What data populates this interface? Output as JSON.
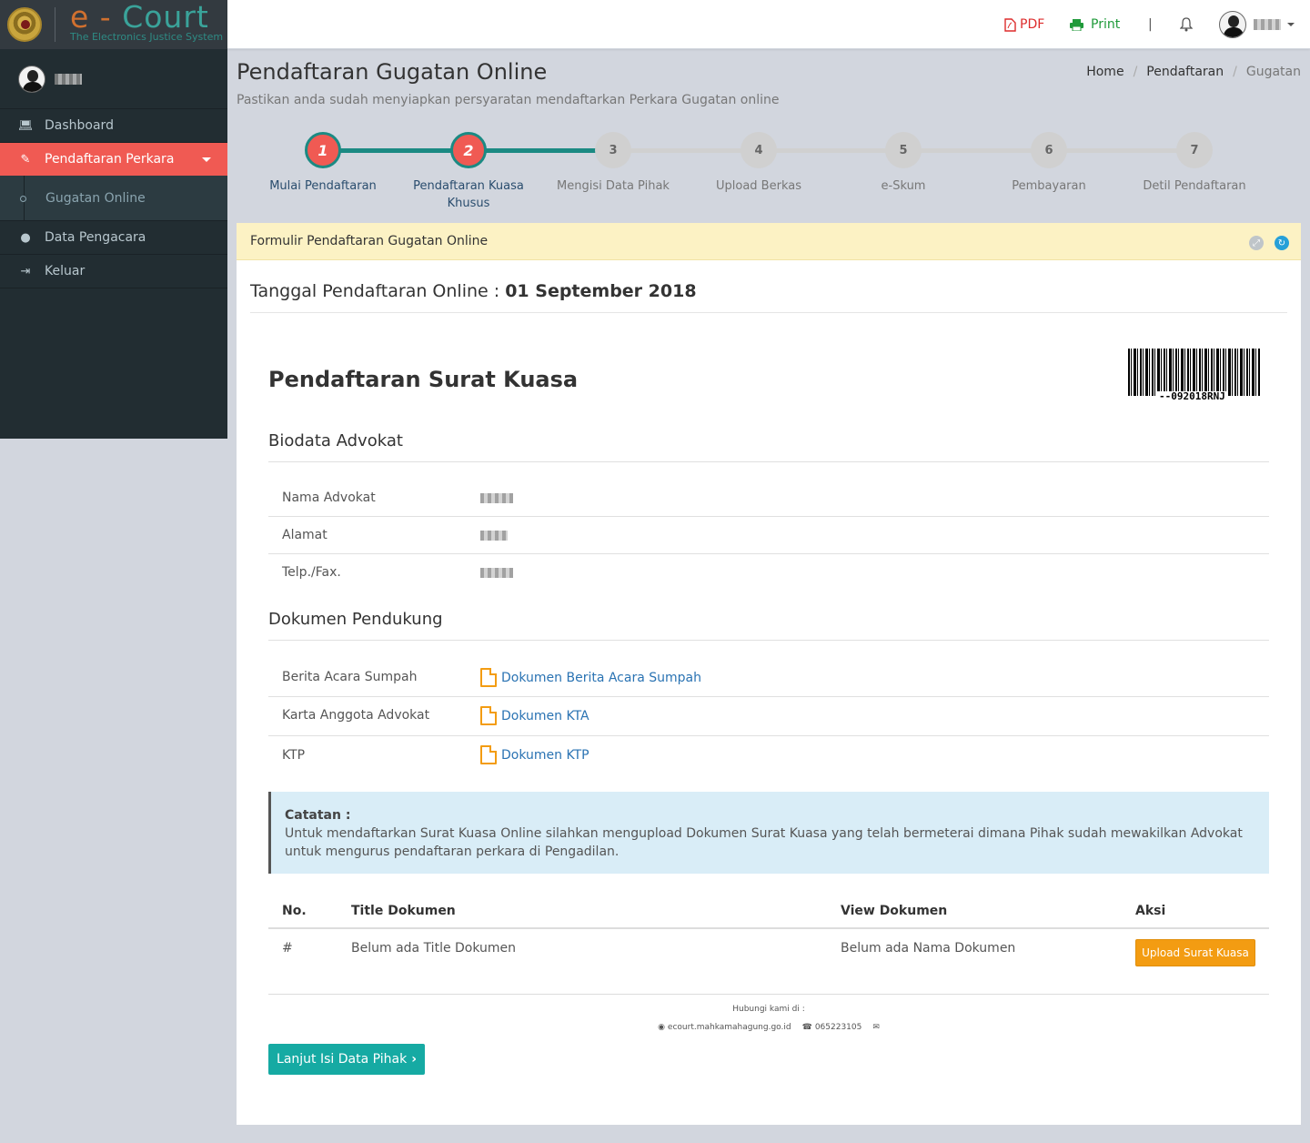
{
  "brand": {
    "title_prefix": "e - ",
    "title_suffix": "Court",
    "subtitle": "The Electronics Justice System"
  },
  "sidebar": {
    "items": [
      {
        "label": "Dashboard",
        "icon": "laptop-icon"
      },
      {
        "label": "Pendaftaran Perkara",
        "icon": "edit-icon",
        "active": true
      },
      {
        "label": "Data Pengacara",
        "icon": "user-icon"
      },
      {
        "label": "Keluar",
        "icon": "sign-out-icon"
      }
    ],
    "submenu": {
      "label": "Gugatan Online"
    }
  },
  "topbar": {
    "pdf_label": "PDF",
    "print_label": "Print",
    "divider": "|"
  },
  "header": {
    "title": "Pendaftaran Gugatan Online",
    "subtitle": "Pastikan anda sudah menyiapkan persyaratan mendaftarkan Perkara Gugatan online",
    "breadcrumb": [
      "Home",
      "Pendaftaran",
      "Gugatan"
    ]
  },
  "steps": [
    {
      "num": "1",
      "label": "Mulai Pendaftaran",
      "done": true
    },
    {
      "num": "2",
      "label": "Pendaftaran Kuasa Khusus",
      "done": true
    },
    {
      "num": "3",
      "label": "Mengisi Data Pihak",
      "done": false
    },
    {
      "num": "4",
      "label": "Upload Berkas",
      "done": false
    },
    {
      "num": "5",
      "label": "e-Skum",
      "done": false
    },
    {
      "num": "6",
      "label": "Pembayaran",
      "done": false
    },
    {
      "num": "7",
      "label": "Detil Pendaftaran",
      "done": false
    }
  ],
  "box": {
    "title": "Formulir Pendaftaran Gugatan Online",
    "tanggal_label": "Tanggal Pendaftaran Online : ",
    "tanggal_value": "01 September 2018",
    "heading": "Pendaftaran Surat Kuasa",
    "barcode_text": "--092018RNJ",
    "biodata": {
      "heading": "Biodata Advokat",
      "rows": [
        {
          "label": "Nama Advokat"
        },
        {
          "label": "Alamat"
        },
        {
          "label": "Telp./Fax."
        }
      ]
    },
    "dokumen": {
      "heading": "Dokumen Pendukung",
      "rows": [
        {
          "label": "Berita Acara Sumpah",
          "link": "Dokumen Berita Acara Sumpah"
        },
        {
          "label": "Karta Anggota Advokat",
          "link": "Dokumen KTA"
        },
        {
          "label": "KTP",
          "link": "Dokumen KTP"
        }
      ]
    },
    "note": {
      "title": "Catatan :",
      "text": "Untuk mendaftarkan Surat Kuasa Online silahkan mengupload Dokumen Surat Kuasa yang telah bermeterai dimana Pihak sudah mewakilkan Advokat untuk mengurus pendaftaran perkara di Pengadilan."
    },
    "table": {
      "headers": [
        "No.",
        "Title Dokumen",
        "View Dokumen",
        "Aksi"
      ],
      "row": {
        "no": "#",
        "title": "Belum ada Title Dokumen",
        "view": "Belum ada Nama Dokumen",
        "action": "Upload Surat Kuasa"
      }
    },
    "contact": {
      "heading": "Hubungi kami di :",
      "website": "ecourt.mahkamahagung.go.id",
      "phone": "065223105"
    },
    "next_button": "Lanjut Isi Data Pihak"
  },
  "colors": {
    "accent": "#f05a53",
    "teal": "#16aaa3",
    "sidebar": "#222d32",
    "warning": "#f39c12"
  }
}
